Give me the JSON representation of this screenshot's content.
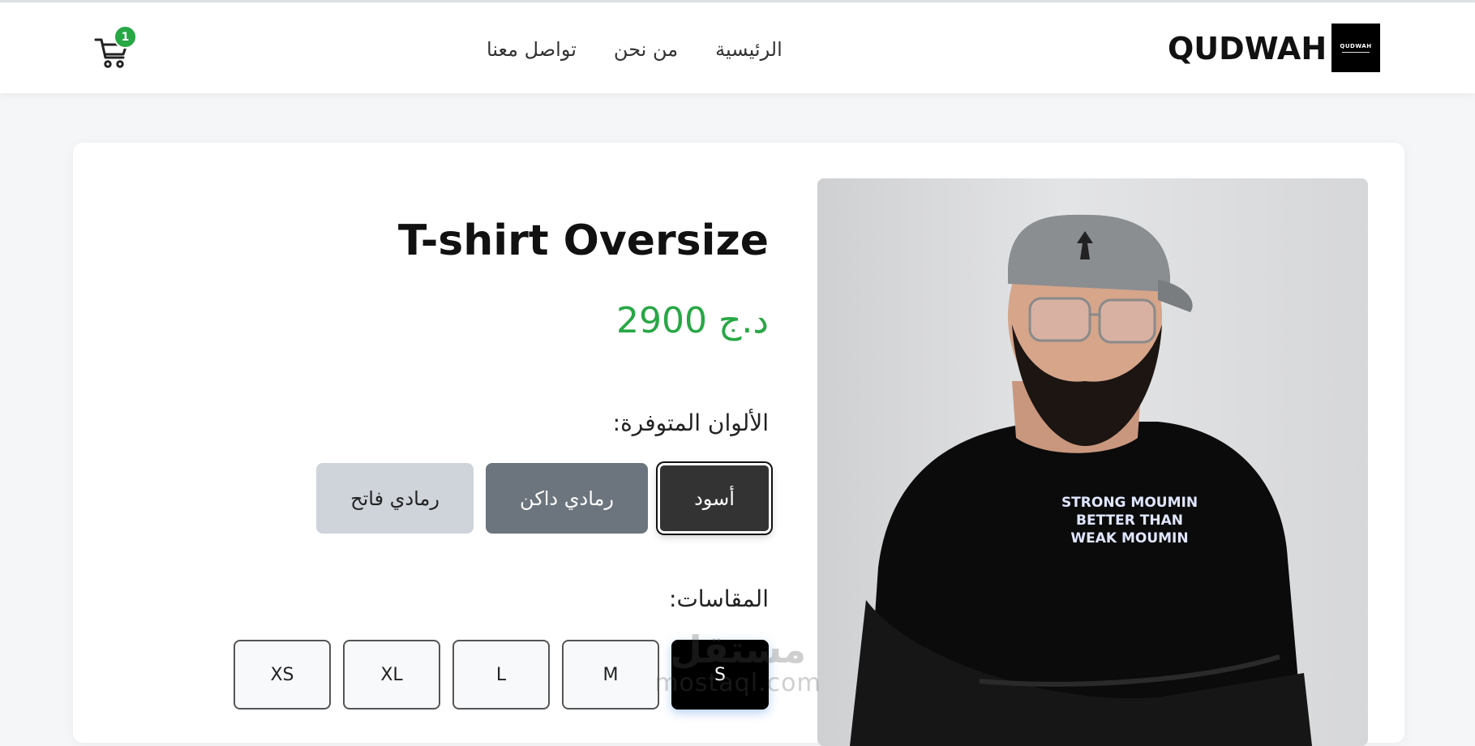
{
  "header": {
    "brand": "QUDWAH",
    "logo_text": "QUDWAH",
    "nav": [
      {
        "label": "الرئيسية"
      },
      {
        "label": "من نحن"
      },
      {
        "label": "تواصل معنا"
      }
    ],
    "cart_count": "1"
  },
  "product": {
    "title": "T-shirt Oversize",
    "price": "2900 د.ج",
    "colors_label": "الألوان المتوفرة:",
    "colors": [
      {
        "label": "أسود",
        "hex": "#333333",
        "selected": true
      },
      {
        "label": "رمادي داكن",
        "hex": "#6c757d",
        "selected": false
      },
      {
        "label": "رمادي فاتح",
        "hex": "#ced4da",
        "selected": false
      }
    ],
    "sizes_label": "المقاسات:",
    "sizes": [
      {
        "label": "S",
        "selected": true
      },
      {
        "label": "M",
        "selected": false
      },
      {
        "label": "L",
        "selected": false
      },
      {
        "label": "XL",
        "selected": false
      },
      {
        "label": "XS",
        "selected": false
      }
    ],
    "shirt_print": [
      "STRONG MOUMIN",
      "BETTER THAN",
      "WEAK MOUMIN"
    ]
  },
  "watermark": {
    "arabic": "مستقل",
    "latin": "mostaql.com"
  },
  "colors": {
    "accent_green": "#28a745",
    "header_bg": "#ffffff",
    "page_bg": "#f4f6f8"
  }
}
